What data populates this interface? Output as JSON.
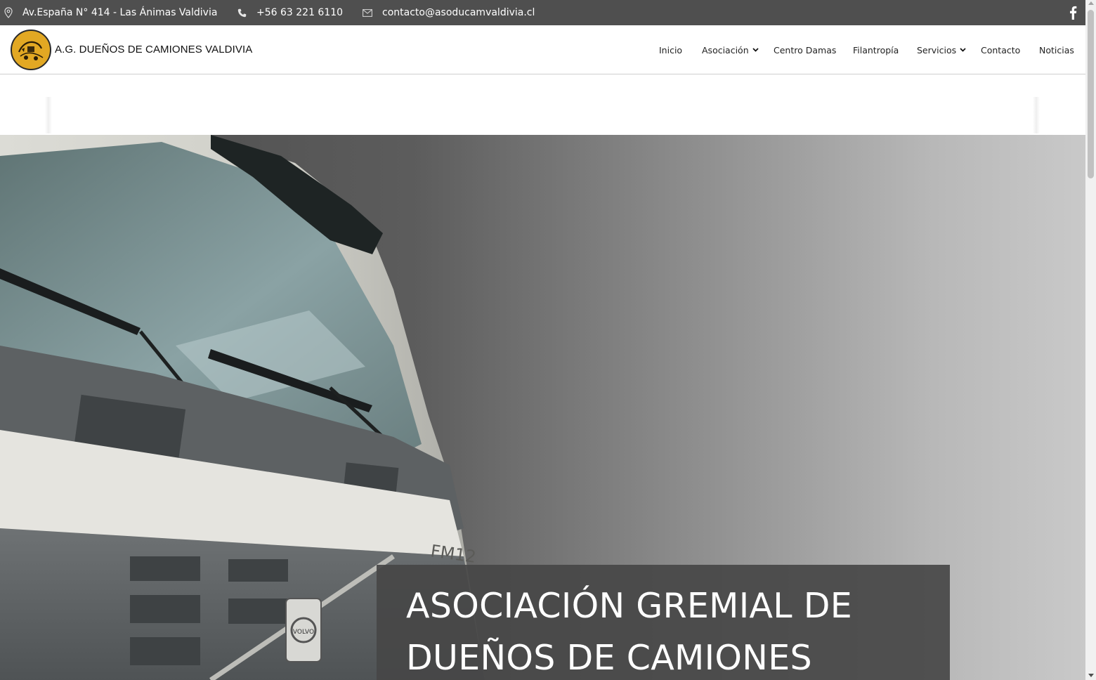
{
  "topbar": {
    "address": "Av.España N° 414 - Las Ánimas Valdivia",
    "phone": "+56 63 221 6110",
    "email": "contacto@asoducamvaldivia.cl",
    "social_icon": "facebook-icon",
    "background": "#4f4f4f"
  },
  "header": {
    "logo_text": "A.G. DUEÑOS DE CAMIONES VALDIVIA",
    "logo_color": "#e2a823",
    "nav": [
      {
        "label": "Inicio",
        "dropdown": false
      },
      {
        "label": "Asociación",
        "dropdown": true
      },
      {
        "label": "Centro Damas",
        "dropdown": false
      },
      {
        "label": "Filantropía",
        "dropdown": false
      },
      {
        "label": "Servicios",
        "dropdown": true
      },
      {
        "label": "Contacto",
        "dropdown": false
      },
      {
        "label": "Noticias",
        "dropdown": false
      }
    ]
  },
  "hero": {
    "title": "ASOCIACIÓN GREMIAL DE DUEÑOS DE CAMIONES",
    "truck_badge": "FM12",
    "grille_logo": "VOLVO",
    "overlay_color": "#464646"
  }
}
